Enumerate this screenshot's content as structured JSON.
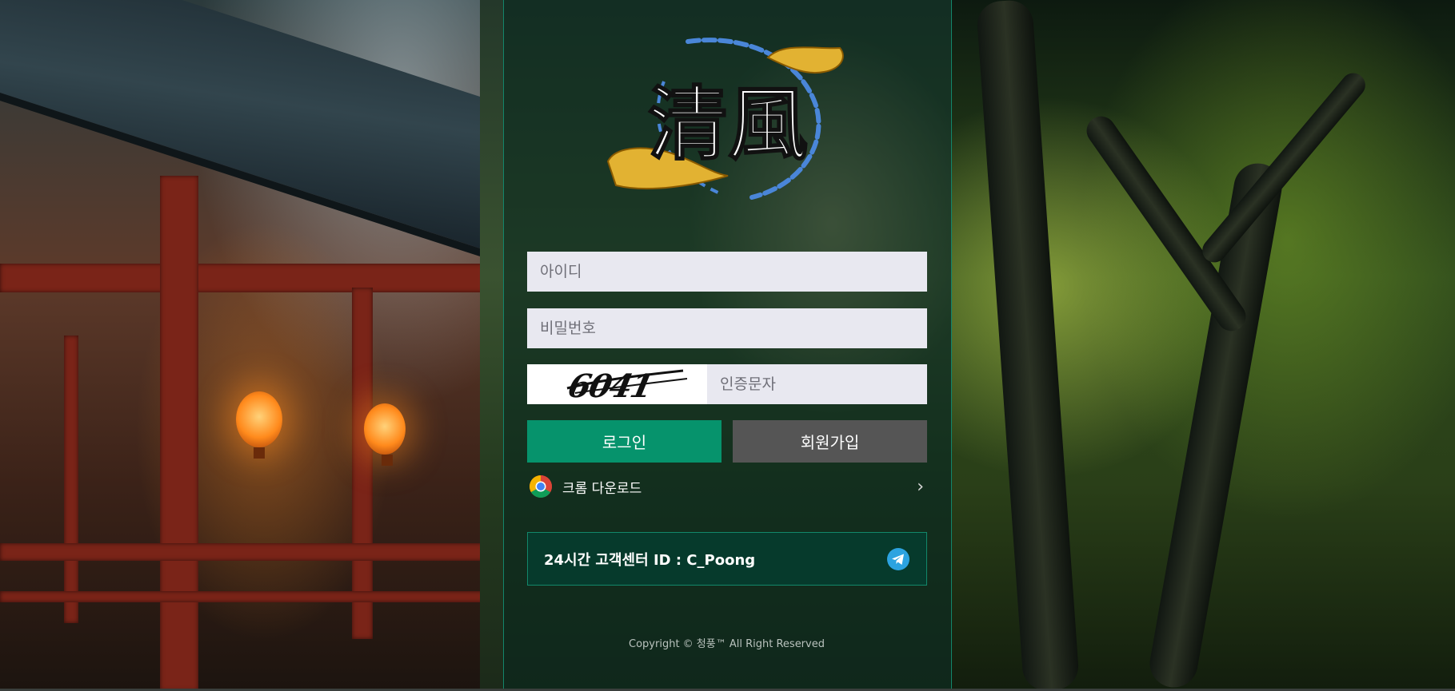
{
  "logo": {
    "text": "清風",
    "colors": {
      "ink": "#ffffff",
      "gold": "#e2b232",
      "blue": "#4a86d8"
    }
  },
  "form": {
    "id_placeholder": "아이디",
    "password_placeholder": "비밀번호",
    "captcha_text": "6041",
    "captcha_placeholder": "인증문자",
    "login_label": "로그인",
    "join_label": "회원가입"
  },
  "chrome": {
    "label": "크롬 다운로드",
    "icon": "chrome-icon",
    "chevron": "›"
  },
  "support": {
    "label": "24시간 고객센터 ID : C_Poong",
    "icon": "telegram-icon"
  },
  "footer": {
    "copyright": "Copyright © 청풍™ All Right Reserved"
  },
  "colors": {
    "accent": "#06936c",
    "join_button": "#555555",
    "panel_border": "#13856a",
    "input_bg": "#e8e8f0"
  }
}
